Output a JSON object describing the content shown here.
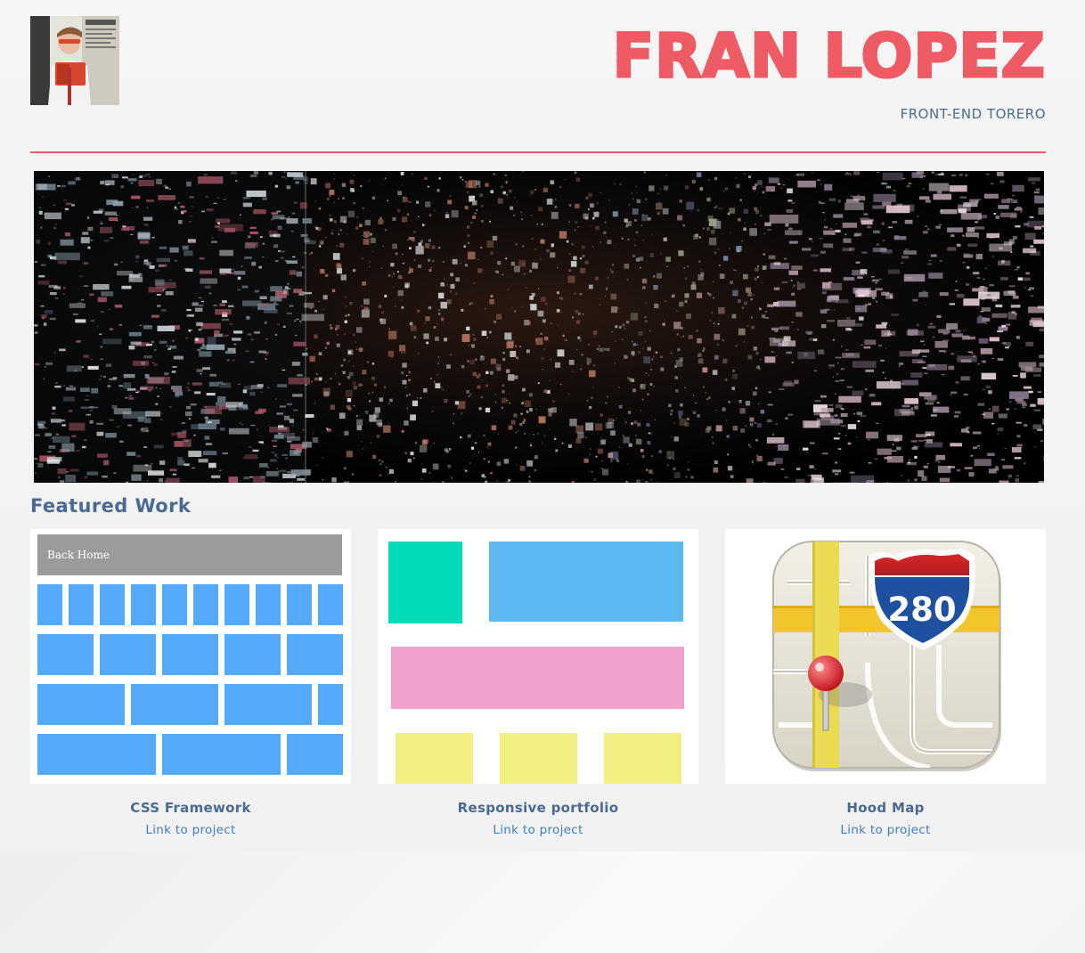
{
  "header": {
    "name": "FRAN LOPEZ",
    "tagline": "FRONT-END TORERO"
  },
  "featured": {
    "title": "Featured Work",
    "projects": [
      {
        "title": "CSS Framework",
        "link": "Link to project",
        "thumb_label": "Back Home"
      },
      {
        "title": "Responsive portfolio",
        "link": "Link to project"
      },
      {
        "title": "Hood Map",
        "link": "Link to project",
        "badge_number": "280"
      }
    ]
  },
  "colors": {
    "accent": "#ef5b65",
    "heading": "#4a6a93",
    "link": "#3e7fbf"
  }
}
